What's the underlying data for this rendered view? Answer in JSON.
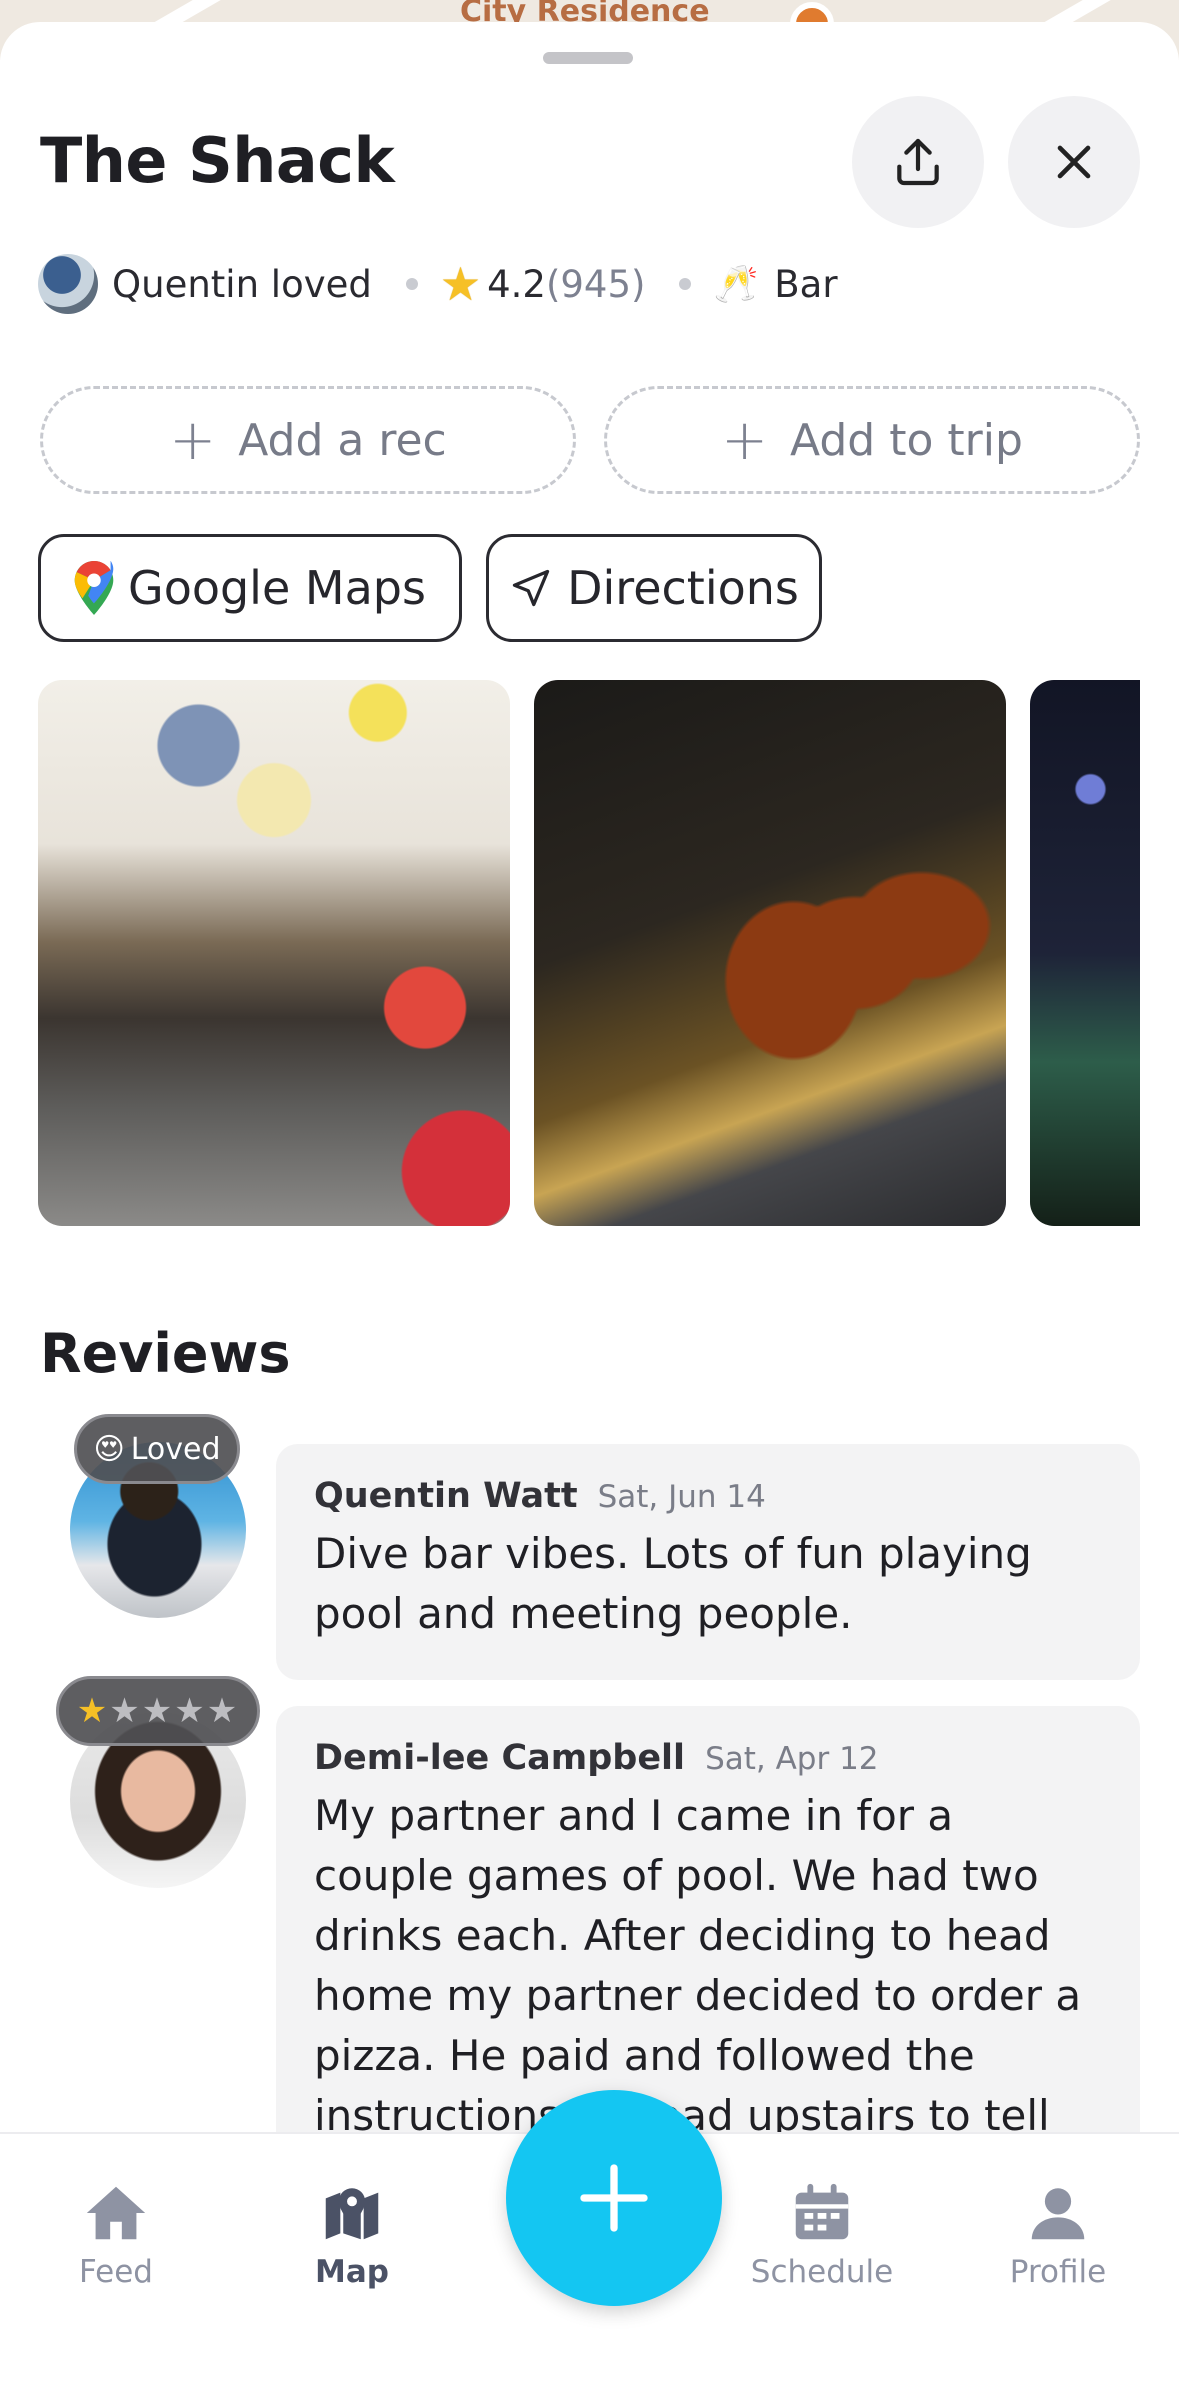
{
  "map_peek": {
    "label": "City Residence"
  },
  "place": {
    "title": "The Shack",
    "loved_by": "Quentin loved",
    "rating": "4.2",
    "rating_count": "(945)",
    "category": "Bar"
  },
  "actions": {
    "add_rec": "Add a rec",
    "add_trip": "Add to trip",
    "google_maps": "Google Maps",
    "directions": "Directions"
  },
  "reviews": {
    "title": "Reviews",
    "items": [
      {
        "badge": "Loved",
        "name": "Quentin Watt",
        "date": "Sat, Jun 14",
        "text": "Dive bar vibes. Lots of fun playing pool and meeting people."
      },
      {
        "stars": 1,
        "name": "Demi-lee Campbell",
        "date": "Sat, Apr 12",
        "text": "My partner and I came in for a couple games of pool. We had two drinks each. After deciding to head home my partner decided to order a pizza. He paid and followed the instructions to head upstairs to tell"
      }
    ]
  },
  "nav": {
    "feed": "Feed",
    "map": "Map",
    "schedule": "Schedule",
    "profile": "Profile",
    "active": "Map"
  },
  "colors": {
    "accent": "#14c6f2",
    "star": "#f6c026",
    "muted": "#8e93a3"
  },
  "icons": [
    "share-icon",
    "close-icon",
    "star-icon",
    "champagne-icon",
    "plus-icon",
    "google-maps-pin-icon",
    "navigation-arrow-icon",
    "home-icon",
    "map-icon",
    "calendar-icon",
    "person-icon"
  ]
}
